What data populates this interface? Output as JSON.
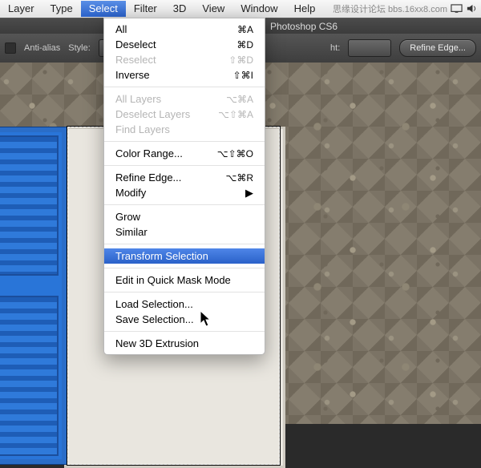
{
  "menubar": {
    "items": [
      "Layer",
      "Type",
      "Select",
      "Filter",
      "3D",
      "View",
      "Window",
      "Help"
    ],
    "selected_index": 2,
    "right_watermark": "思缘设计论坛   bbs.16xx8.com"
  },
  "app": {
    "title_suffix": "Photoshop CS6"
  },
  "options": {
    "anti_alias_label": "Anti-alias",
    "style_label": "Style:",
    "ht_label": "ht:",
    "refine_btn": "Refine Edge..."
  },
  "menu": [
    {
      "label": "All",
      "shortcut": "⌘A",
      "disabled": false
    },
    {
      "label": "Deselect",
      "shortcut": "⌘D",
      "disabled": false
    },
    {
      "label": "Reselect",
      "shortcut": "⇧⌘D",
      "disabled": true
    },
    {
      "label": "Inverse",
      "shortcut": "⇧⌘I",
      "disabled": false
    },
    {
      "sep": true
    },
    {
      "label": "All Layers",
      "shortcut": "⌥⌘A",
      "disabled": true
    },
    {
      "label": "Deselect Layers",
      "shortcut": "⌥⇧⌘A",
      "disabled": true
    },
    {
      "label": "Find Layers",
      "shortcut": "",
      "disabled": true
    },
    {
      "sep": true
    },
    {
      "label": "Color Range...",
      "shortcut": "⌥⇧⌘O",
      "disabled": false
    },
    {
      "sep": true
    },
    {
      "label": "Refine Edge...",
      "shortcut": "⌥⌘R",
      "disabled": false
    },
    {
      "label": "Modify",
      "shortcut": "",
      "disabled": false,
      "submenu": true
    },
    {
      "sep": true
    },
    {
      "label": "Grow",
      "shortcut": "",
      "disabled": false
    },
    {
      "label": "Similar",
      "shortcut": "",
      "disabled": false
    },
    {
      "sep": true
    },
    {
      "label": "Transform Selection",
      "shortcut": "",
      "disabled": false,
      "highlight": true
    },
    {
      "sep": true
    },
    {
      "label": "Edit in Quick Mask Mode",
      "shortcut": "",
      "disabled": false
    },
    {
      "sep": true
    },
    {
      "label": "Load Selection...",
      "shortcut": "",
      "disabled": false
    },
    {
      "label": "Save Selection...",
      "shortcut": "",
      "disabled": false
    },
    {
      "sep": true
    },
    {
      "label": "New 3D Extrusion",
      "shortcut": "",
      "disabled": false
    }
  ]
}
